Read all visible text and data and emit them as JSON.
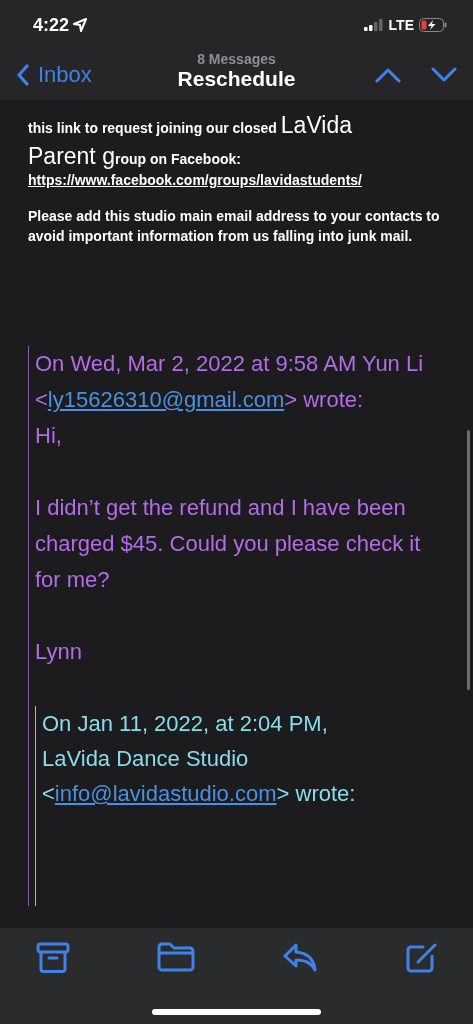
{
  "status_bar": {
    "time": "4:22",
    "network": "LTE"
  },
  "nav": {
    "back": "Inbox",
    "subtitle": "8 Messages",
    "title": "Reschedule"
  },
  "body": [
    {
      "kind": "text",
      "text": "this link to request joining our closed **LaVida Parent g**roup on Facebook:"
    },
    {
      "kind": "link",
      "text": "https://www.facebook.com/groups/lavidastudents/"
    },
    {
      "kind": "paragraph",
      "text": "Please add this studio main email address to your contacts to avoid important information from us falling into junk mail."
    }
  ],
  "quote": {
    "header_before": "On Wed, Mar 2, 2022 at 9:58 AM Yun Li <",
    "email": "ly15626310@gmail.com",
    "header_after": "> wrote:",
    "lines": [
      "Hi,",
      "I didn’t get the refund and I have been charged $45. Could you please check it for me?",
      "Lynn"
    ],
    "nested": {
      "header_before": "On Jan 11, 2022, at 2:04 PM, LaVida Dance Studio <",
      "email": "info@lavidastudio.com",
      "header_after": "> wrote:"
    }
  }
}
